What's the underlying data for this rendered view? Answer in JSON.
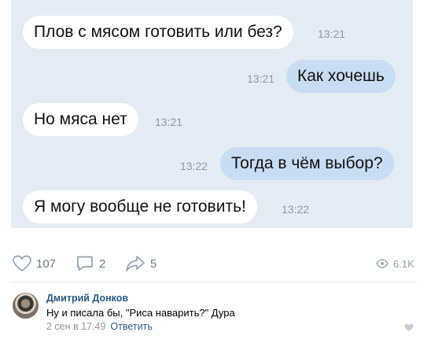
{
  "messages": [
    {
      "text": "Плов с мясом готовить или без?",
      "time": "13:21",
      "direction": "in"
    },
    {
      "text": "Как хочешь",
      "time": "13:21",
      "direction": "out"
    },
    {
      "text": "Но мяса нет",
      "time": "13:21",
      "direction": "in"
    },
    {
      "text": "Тогда в чём выбор?",
      "time": "13:22",
      "direction": "out"
    },
    {
      "text": "Я могу вообще не готовить!",
      "time": "13:22",
      "direction": "in"
    }
  ],
  "post_actions": {
    "likes": "107",
    "comments": "2",
    "shares": "5",
    "views": "6.1K"
  },
  "comment": {
    "author": "Дмитрий Донков",
    "text": "Ну и писала бы, \"Риса наварить?\" Дура",
    "date": "2 сен в 17:49",
    "reply_label": "Ответить"
  },
  "colors": {
    "chat_bg": "#e5ebf2",
    "outgoing_bubble": "#c9dcf2",
    "incoming_bubble": "#ffffff",
    "link": "#2a5885"
  },
  "icons": [
    "heart-icon",
    "comment-icon",
    "share-icon",
    "eye-icon",
    "like-heart-icon"
  ]
}
